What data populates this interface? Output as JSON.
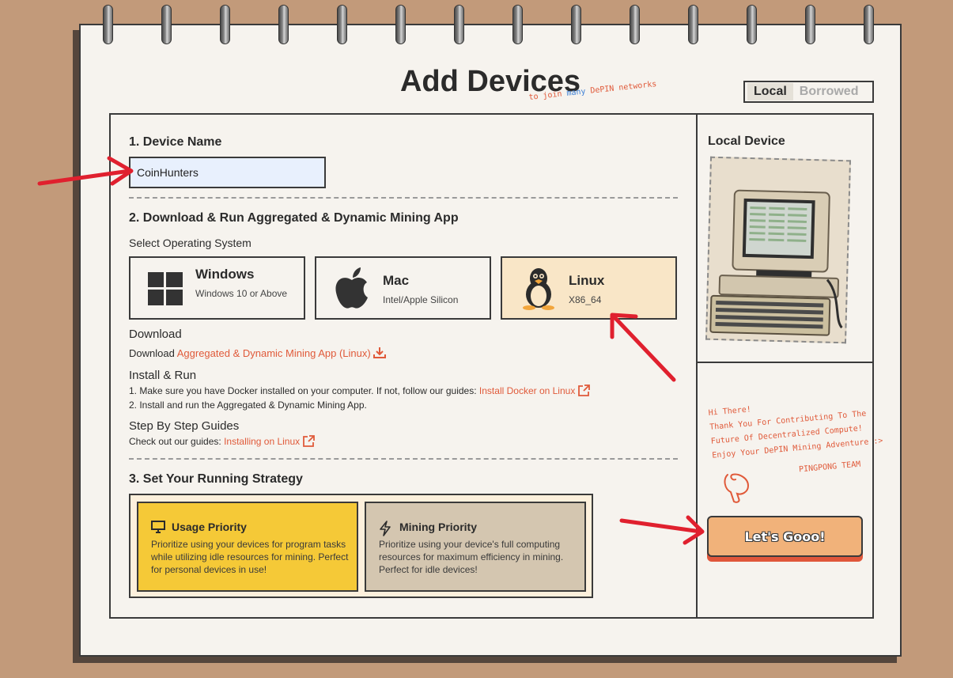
{
  "header": {
    "title": "Add Devices",
    "subtitle_prefix": "to join",
    "subtitle_highlight": "many",
    "subtitle_suffix": "DePIN networks",
    "toggle": {
      "local": "Local",
      "borrowed": "Borrowed",
      "active": "Local"
    }
  },
  "section1": {
    "heading": "1. Device Name",
    "device_name_value": "CoinHunters"
  },
  "section2": {
    "heading": "2. Download & Run Aggregated & Dynamic Mining App",
    "select_os_label": "Select Operating System",
    "os_options": [
      {
        "name": "Windows",
        "sub": "Windows 10 or Above",
        "icon": "windows-icon"
      },
      {
        "name": "Mac",
        "sub": "Intel/Apple Silicon",
        "icon": "apple-icon"
      },
      {
        "name": "Linux",
        "sub": "X86_64",
        "icon": "linux-tux-icon"
      }
    ],
    "selected_os": "Linux",
    "download": {
      "heading": "Download",
      "prefix": "Download",
      "link": "Aggregated & Dynamic Mining App (Linux)",
      "icon": "download-icon"
    },
    "install": {
      "heading": "Install & Run",
      "step1_text": "1. Make sure you have Docker installed on your computer. If not, follow our guides:",
      "step1_link": "Install Docker on Linux",
      "step2_text": "2. Install and run the Aggregated & Dynamic Mining App."
    },
    "guides": {
      "heading": "Step By Step Guides",
      "prefix": "Check out our guides:",
      "link": "Installing on Linux"
    }
  },
  "section3": {
    "heading": "3. Set Your Running Strategy",
    "strategies": [
      {
        "title": "Usage Priority",
        "desc": "Prioritize using your devices for program tasks while utilizing idle resources for mining. Perfect for personal devices in use!",
        "icon": "monitor-icon"
      },
      {
        "title": "Mining Priority",
        "desc": "Prioritize using your device's full computing resources for maximum efficiency in mining. Perfect for idle devices!",
        "icon": "lightning-icon"
      }
    ],
    "selected_strategy": "Usage Priority"
  },
  "sidebar": {
    "device_label": "Local Device",
    "device_image": "retro-computer-illustration",
    "note_lines": [
      "Hi There!",
      "Thank You For Contributing To The",
      "Future Of Decentralized Compute!",
      "Enjoy Your DePIN Mining Adventure :>"
    ],
    "signature": "PINGPONG TEAM",
    "cta_label": "Let's Gooo!"
  },
  "colors": {
    "background": "#c29a7a",
    "paper": "#f6f3ee",
    "accent": "#e05a3a",
    "input_bg": "#e8f0fd",
    "selected_os_bg": "#f9e6c7",
    "usage_bg": "#f5c937",
    "mining_bg": "#d4c6b0",
    "cta_bg": "#f1b27a",
    "arrow": "#e0202e"
  }
}
